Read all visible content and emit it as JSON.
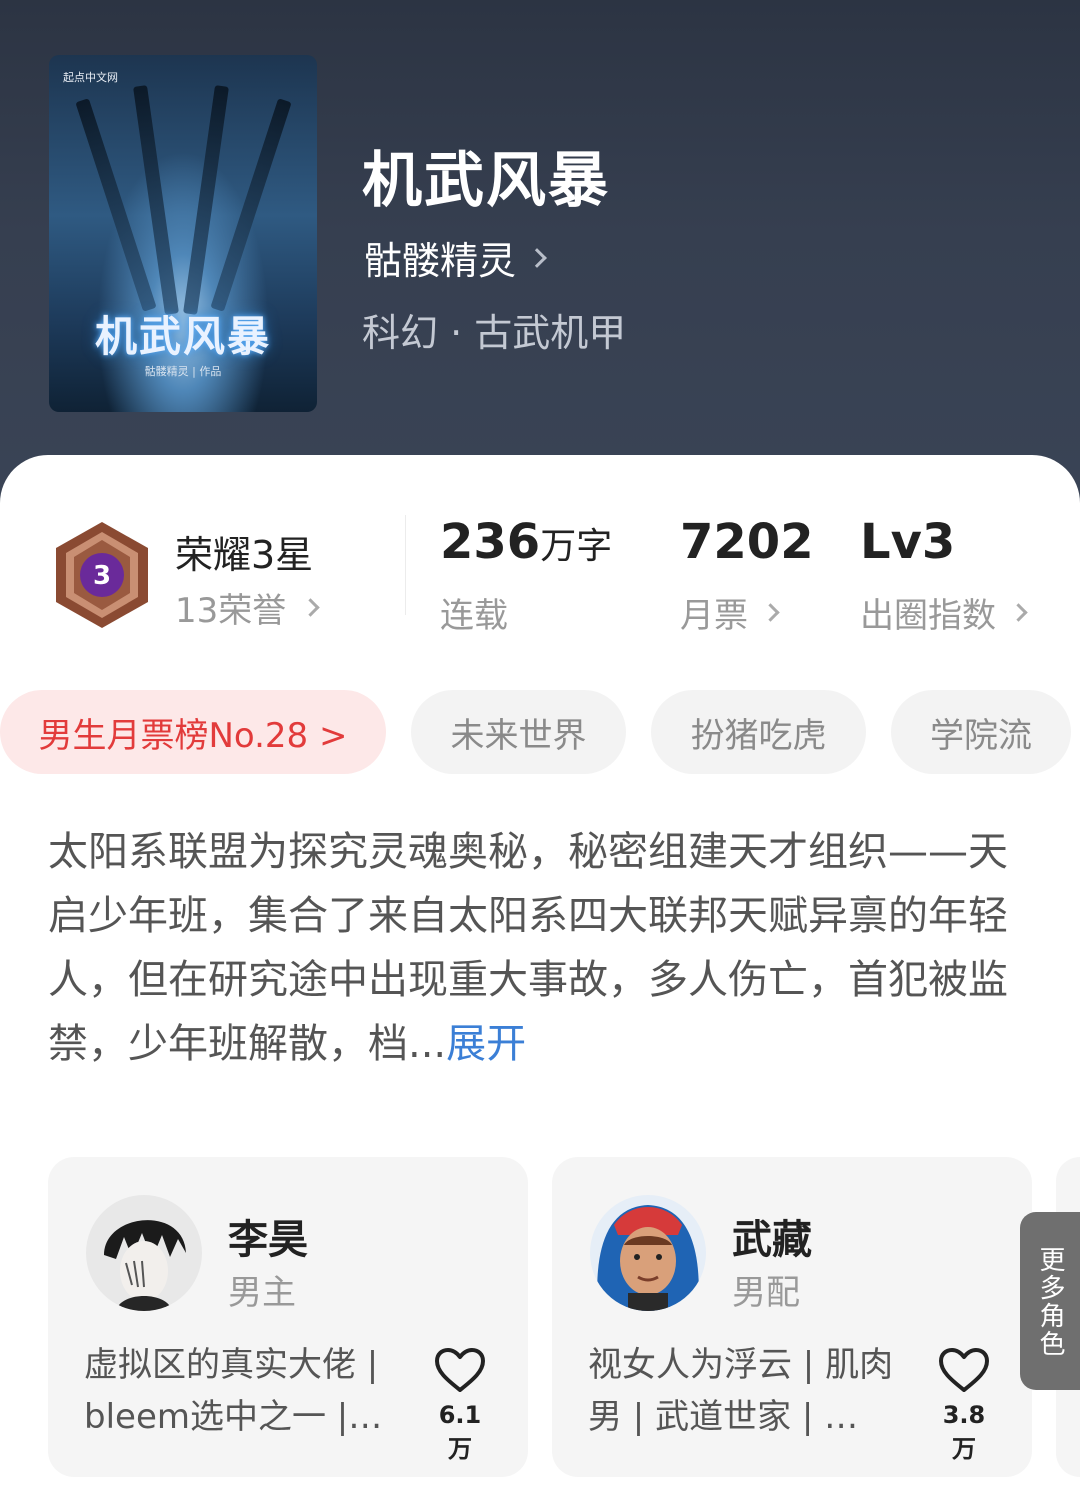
{
  "book": {
    "title": "机武风暴",
    "author": "骷髅精灵",
    "genre": "科幻 · 古武机甲",
    "cover": {
      "publisher": "起点中文网",
      "title": "机武风暴",
      "byline": "骷髅精灵 | 作品"
    }
  },
  "honor": {
    "level_number": "3",
    "title": "荣耀3星",
    "sub": "13荣誉"
  },
  "stats": {
    "words_value": "236",
    "words_unit": "万字",
    "words_label": "连载",
    "tickets_value": "7202",
    "tickets_label": "月票",
    "index_value": "Lv3",
    "index_label": "出圈指数"
  },
  "tags": {
    "rank": "男生月票榜No.28 >",
    "items": [
      "未来世界",
      "扮猪吃虎",
      "学院流"
    ]
  },
  "synopsis": {
    "text": "太阳系联盟为探究灵魂奥秘，秘密组建天才组织——天启少年班，集合了来自太阳系四大联邦天赋异禀的年轻人，但在研究途中出现重大事故，多人伤亡，首犯被监禁，少年班解散，档...",
    "expand": "展开"
  },
  "characters": [
    {
      "name": "李昊",
      "role": "男主",
      "desc": "虚拟区的真实大佬 | bleem选中之一 |…",
      "likes": "6.1万"
    },
    {
      "name": "武藏",
      "role": "男配",
      "desc": "视女人为浮云 | 肌肉男 | 武道世家 | …",
      "likes": "3.8万"
    }
  ],
  "more_roles": "更多角色",
  "colors": {
    "hero_bg": "#323b4b",
    "rank_tag_bg": "#fde8e8",
    "rank_tag_text": "#e23b3b",
    "expand_link": "#3b7fd6",
    "badge_purple": "#6a2a9a",
    "badge_bronze": "#8a4a32"
  }
}
